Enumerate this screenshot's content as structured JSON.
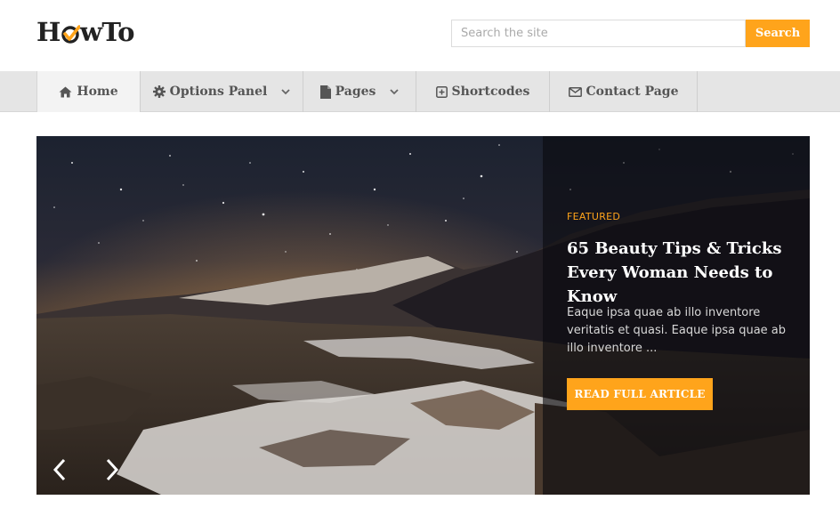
{
  "logo": {
    "part1": "H",
    "part2": "wTo"
  },
  "search": {
    "placeholder": "Search the site",
    "button_label": "Search"
  },
  "nav": {
    "items": [
      {
        "label": "Home",
        "icon": "home-icon",
        "active": true
      },
      {
        "label": "Options Panel",
        "icon": "gear-icon",
        "dropdown": true
      },
      {
        "label": "Pages",
        "icon": "file-icon",
        "dropdown": true
      },
      {
        "label": "Shortcodes",
        "icon": "plus-square-icon"
      },
      {
        "label": "Contact Page",
        "icon": "envelope-icon"
      }
    ]
  },
  "slider": {
    "tag": "FEATURED",
    "title": "65 Beauty Tips & Tricks Every Woman Needs to Know",
    "excerpt": "Eaque ipsa quae ab illo inventore veritatis et quasi. Eaque ipsa quae ab illo inventore ...",
    "button_label": "READ FULL ARTICLE"
  },
  "colors": {
    "accent": "#ffa41b",
    "nav_bg": "#e5e5e5",
    "text_dark": "#222222"
  }
}
